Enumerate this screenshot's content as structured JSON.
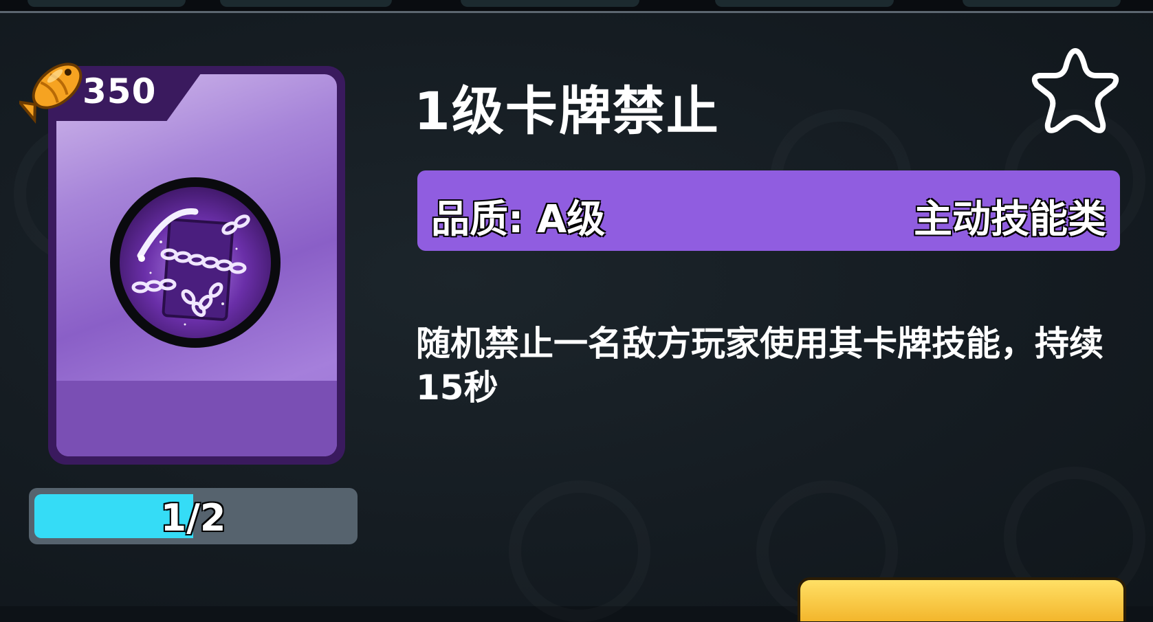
{
  "card": {
    "title": "1级卡牌禁止",
    "price": "350",
    "price_icon": "fish-coin-icon",
    "emblem_icon": "chained-card-icon",
    "progress": {
      "text": "1/2",
      "fraction": 0.5
    },
    "quality_label": "品质: A级",
    "category_label": "主动技能类",
    "description": "随机禁止一名敌方玩家使用其卡牌技能，持续15秒",
    "favorite_icon": "star-outline-icon"
  },
  "colors": {
    "background": "#121a20",
    "card_border": "#3a1a5e",
    "card_purple": "#9a73d6",
    "quality_bar": "#905de0",
    "progress_fill": "#35dcf6",
    "progress_track": "#56636e",
    "button_yellow": "#f8c63e"
  },
  "action_button": {
    "label": ""
  }
}
